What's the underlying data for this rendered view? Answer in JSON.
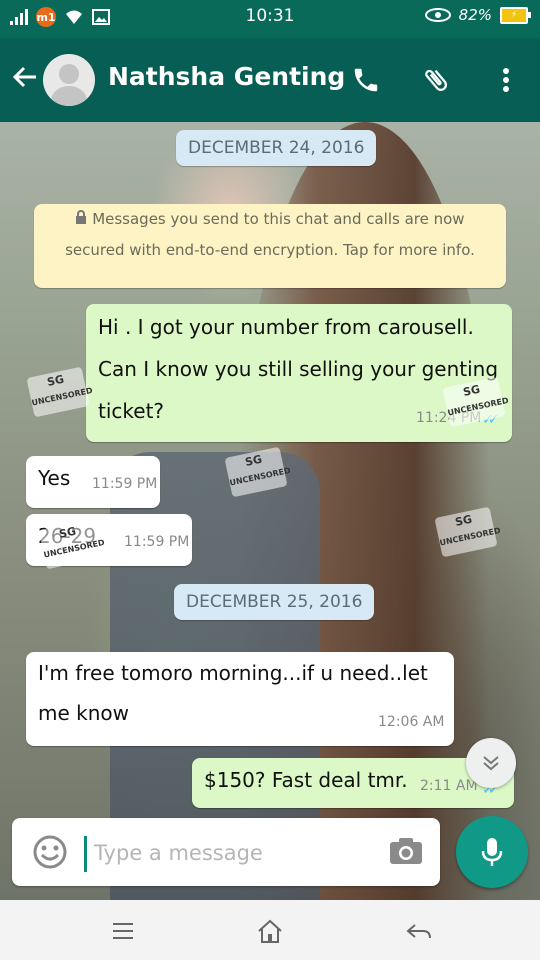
{
  "status_bar": {
    "time": "10:31",
    "battery": "82%",
    "carrier_badge": "m1",
    "accent": "#0a6a5a"
  },
  "header": {
    "contact_name": "Nathsha Genting",
    "icons": [
      "back-arrow-icon",
      "avatar",
      "phone-icon",
      "paperclip-icon",
      "more-vert-icon"
    ],
    "color": "#075e54"
  },
  "messages": [
    {
      "type": "date",
      "text": "DECEMBER 24, 2016"
    },
    {
      "type": "system",
      "line1": "Messages you send to this chat and calls are now",
      "line2": "secured with end-to-end encryption. Tap for more info."
    },
    {
      "type": "outgoing",
      "line1": "Hi . I got your number from carousell.",
      "line2": "Can I know you still selling your genting",
      "line3": "ticket?",
      "time": "11:24 PM",
      "status": "read"
    },
    {
      "type": "incoming",
      "text": "Yes",
      "time": "11:59 PM"
    },
    {
      "type": "incoming",
      "text": "26-29",
      "time": "11:59 PM"
    },
    {
      "type": "date",
      "text": "DECEMBER 25, 2016"
    },
    {
      "type": "incoming",
      "line1": "I'm free tomoro morning...if u need..let",
      "line2": "me know",
      "time": "12:06 AM"
    },
    {
      "type": "outgoing",
      "text": "$150? Fast deal tmr.",
      "time": "2:11 AM",
      "status": "read"
    }
  ],
  "composer": {
    "placeholder": "Type a message"
  },
  "watermark": {
    "line1": "SG",
    "line2": "UNCENSORED"
  },
  "colors": {
    "outgoing_bubble": "#dcf8c6",
    "incoming_bubble": "#ffffff",
    "date_pill": "#d7e9f5",
    "system_notice": "#fdf3c5",
    "mic_button": "#119988"
  }
}
